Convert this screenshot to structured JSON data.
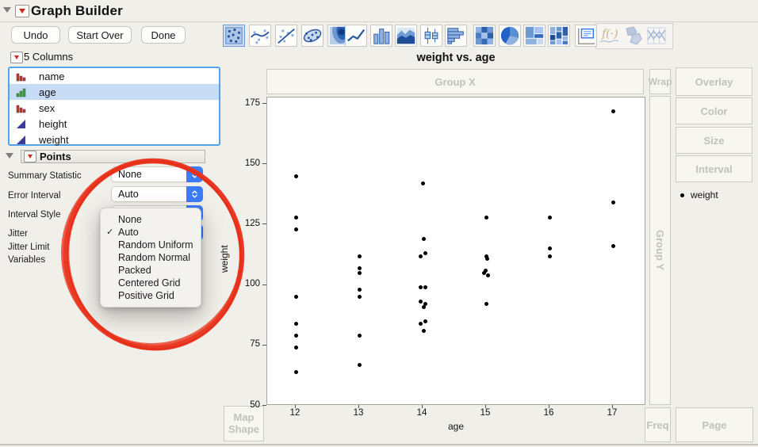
{
  "window": {
    "title": "Graph Builder"
  },
  "toolbar": {
    "buttons": [
      {
        "label": "Undo"
      },
      {
        "label": "Start Over"
      },
      {
        "label": "Done"
      }
    ],
    "chart_icons": [
      {
        "name": "points",
        "selected": true
      },
      {
        "name": "smoother"
      },
      {
        "name": "line-of-fit"
      },
      {
        "name": "ellipse"
      },
      {
        "name": "contour"
      },
      {
        "name": "line"
      },
      {
        "name": "bar"
      },
      {
        "name": "area"
      },
      {
        "name": "box-plot"
      },
      {
        "name": "histogram"
      },
      {
        "name": "heatmap"
      },
      {
        "name": "pie"
      },
      {
        "name": "treemap"
      },
      {
        "name": "mosaic"
      },
      {
        "name": "caption-box"
      },
      {
        "name": "formula",
        "disabled": true
      },
      {
        "name": "map-shape",
        "disabled": true
      },
      {
        "name": "parallel",
        "disabled": true
      }
    ]
  },
  "columns_panel": {
    "header": "5 Columns",
    "items": [
      {
        "label": "name",
        "type": "nominal",
        "selected": false
      },
      {
        "label": "age",
        "type": "ordinal",
        "selected": true
      },
      {
        "label": "sex",
        "type": "nominal",
        "selected": false
      },
      {
        "label": "height",
        "type": "continuous",
        "selected": false
      },
      {
        "label": "weight",
        "type": "continuous",
        "selected": false
      }
    ]
  },
  "points_panel": {
    "title": "Points",
    "rows": [
      {
        "label": "Summary Statistic",
        "control": "select",
        "value": "None"
      },
      {
        "label": "Error Interval",
        "control": "select",
        "value": "Auto"
      },
      {
        "label": "Interval Style",
        "control": "select",
        "value": ""
      },
      {
        "label": "Jitter",
        "control": "select",
        "value": ""
      },
      {
        "label": "Jitter Limit"
      },
      {
        "label": "Variables"
      }
    ]
  },
  "dropdown_menu": {
    "items": [
      {
        "label": "None"
      },
      {
        "label": "Auto",
        "checked": true
      },
      {
        "label": "Random Uniform"
      },
      {
        "label": "Random Normal"
      },
      {
        "label": "Packed"
      },
      {
        "label": "Centered Grid"
      },
      {
        "label": "Positive Grid"
      }
    ]
  },
  "drop_zones": {
    "group_x": "Group X",
    "wrap": "Wrap",
    "overlay": "Overlay",
    "color": "Color",
    "size": "Size",
    "interval": "Interval",
    "group_y": "Group Y",
    "map_shape": "Map Shape",
    "freq": "Freq",
    "page": "Page"
  },
  "legend": {
    "label": "weight"
  },
  "chart_data": {
    "type": "scatter",
    "title": "weight vs. age",
    "xlabel": "age",
    "ylabel": "weight",
    "x_ticks": [
      12,
      13,
      14,
      15,
      16,
      17
    ],
    "y_ticks": [
      175,
      150,
      125,
      100,
      75,
      50
    ],
    "xlim": [
      11.55,
      17.55
    ],
    "ylim": [
      50,
      177.5
    ],
    "grid": false,
    "points": [
      {
        "age": 12,
        "weight": 95,
        "dx": 0
      },
      {
        "age": 12,
        "weight": 123,
        "dx": 0
      },
      {
        "age": 12,
        "weight": 74,
        "dx": 0
      },
      {
        "age": 12,
        "weight": 145,
        "dx": 0
      },
      {
        "age": 12,
        "weight": 64,
        "dx": 0
      },
      {
        "age": 12,
        "weight": 84,
        "dx": 0
      },
      {
        "age": 12,
        "weight": 128,
        "dx": 0
      },
      {
        "age": 12,
        "weight": 79,
        "dx": 0
      },
      {
        "age": 13,
        "weight": 112,
        "dx": 0
      },
      {
        "age": 13,
        "weight": 107,
        "dx": 0
      },
      {
        "age": 13,
        "weight": 67,
        "dx": 0
      },
      {
        "age": 13,
        "weight": 98,
        "dx": 0
      },
      {
        "age": 13,
        "weight": 105,
        "dx": 0
      },
      {
        "age": 13,
        "weight": 95,
        "dx": 0
      },
      {
        "age": 13,
        "weight": 79,
        "dx": 0
      },
      {
        "age": 14,
        "weight": 81,
        "dx": 1
      },
      {
        "age": 14,
        "weight": 91,
        "dx": 1
      },
      {
        "age": 14,
        "weight": 142,
        "dx": 0
      },
      {
        "age": 14,
        "weight": 84,
        "dx": -3
      },
      {
        "age": 14,
        "weight": 85,
        "dx": 3
      },
      {
        "age": 14,
        "weight": 93,
        "dx": -3
      },
      {
        "age": 14,
        "weight": 99,
        "dx": -3
      },
      {
        "age": 14,
        "weight": 119,
        "dx": 1
      },
      {
        "age": 14,
        "weight": 92,
        "dx": 3
      },
      {
        "age": 14,
        "weight": 112,
        "dx": -3
      },
      {
        "age": 14,
        "weight": 99,
        "dx": 3
      },
      {
        "age": 14,
        "weight": 113,
        "dx": 3
      },
      {
        "age": 15,
        "weight": 92,
        "dx": 0
      },
      {
        "age": 15,
        "weight": 112,
        "dx": 0
      },
      {
        "age": 15,
        "weight": 128,
        "dx": 0
      },
      {
        "age": 15,
        "weight": 111,
        "dx": 1
      },
      {
        "age": 15,
        "weight": 105,
        "dx": -3
      },
      {
        "age": 15,
        "weight": 104,
        "dx": 2
      },
      {
        "age": 15,
        "weight": 106,
        "dx": -1
      },
      {
        "age": 16,
        "weight": 112,
        "dx": 0
      },
      {
        "age": 16,
        "weight": 115,
        "dx": 0
      },
      {
        "age": 16,
        "weight": 128,
        "dx": 0
      },
      {
        "age": 17,
        "weight": 116,
        "dx": 0
      },
      {
        "age": 17,
        "weight": 134,
        "dx": 0
      },
      {
        "age": 17,
        "weight": 172,
        "dx": 0
      }
    ]
  },
  "colors": {
    "accent_blue": "#3d7bfe",
    "selection_blue": "#54a3ea",
    "annotation_red": "#e8301d",
    "nominal_red": "#c63a2f",
    "ordinal_green": "#3fa33c",
    "continuous_blue": "#3c3c96",
    "zone_text_gray": "#c3c1bb"
  }
}
